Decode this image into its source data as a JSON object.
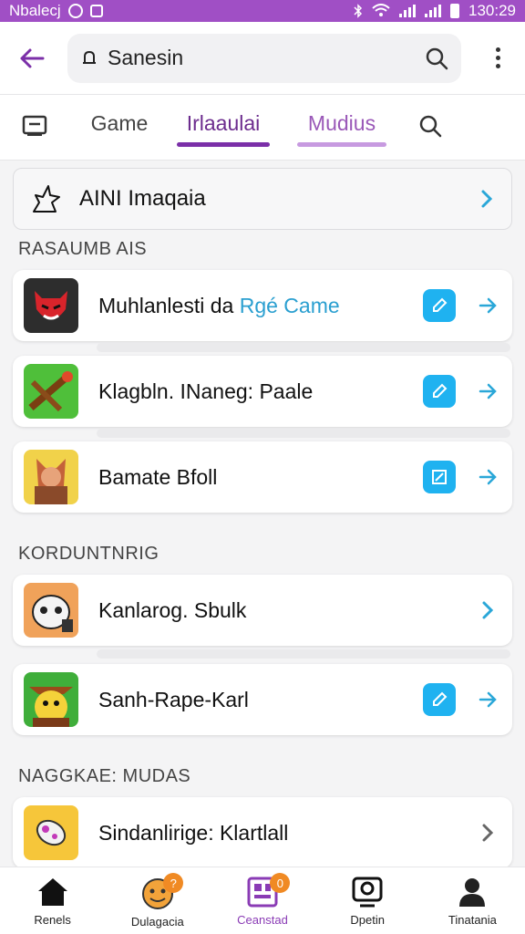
{
  "status_bar": {
    "left_text": "Nbalecj",
    "time": "130:29",
    "bg": "#a04fc5"
  },
  "app_bar": {
    "search_value": "Sanesin",
    "back_icon": "back-arrow-icon",
    "menu_icon": "more-vert-icon"
  },
  "tabs": [
    {
      "label": "Game"
    },
    {
      "label": "Irlaaulai",
      "active": true
    },
    {
      "label": "Mudius",
      "active": true
    }
  ],
  "featured": {
    "title": "AINI Imaqaia",
    "icon": "unicorn-icon"
  },
  "sections": [
    {
      "label": "RASAUMB AIS",
      "items": [
        {
          "name": "Muhlanlesti da ",
          "highlight": "Rgé Came",
          "thumb": "devil-mask-icon",
          "editable": true,
          "arrow_color": "#2aa7d8"
        },
        {
          "name": "Klagbln. INaneg: Paale",
          "highlight": "",
          "thumb": "crossbow-icon",
          "editable": true,
          "arrow_color": "#2aa7d8"
        },
        {
          "name": "Bamate Bfoll",
          "highlight": "",
          "thumb": "warrior-icon",
          "editable": true,
          "arrow_color": "#2aa7d8"
        }
      ]
    },
    {
      "label": "KORDUNTNRIG",
      "items": [
        {
          "name": "Kanlarog. Sbulk",
          "highlight": "",
          "thumb": "panda-icon",
          "editable": false,
          "arrow_color": "#2aa7d8"
        },
        {
          "name": "Sanh-Rape-Karl",
          "highlight": "",
          "thumb": "bird-icon",
          "editable": true,
          "arrow_color": "#2aa7d8"
        }
      ]
    },
    {
      "label": "NAGGKAE: MUDAS",
      "items": [
        {
          "name": "Sindanlirige: Klartlall",
          "highlight": "",
          "thumb": "candy-icon",
          "editable": false,
          "arrow_color": "#666666"
        }
      ]
    }
  ],
  "bottom_nav": [
    {
      "label": "Renels",
      "icon": "home-icon",
      "badge": ""
    },
    {
      "label": "Dulagacia",
      "icon": "emoji-face-icon",
      "badge": "?"
    },
    {
      "label": "Ceanstad",
      "icon": "dashboard-icon",
      "badge": "0",
      "active": true
    },
    {
      "label": "Dpetin",
      "icon": "monitor-icon",
      "badge": ""
    },
    {
      "label": "Tinatania",
      "icon": "person-icon",
      "badge": ""
    }
  ],
  "colors": {
    "accent": "#7b2fa8",
    "accent_light": "#c79ae0",
    "cyan": "#1fb2f0",
    "badge": "#f08a24"
  }
}
